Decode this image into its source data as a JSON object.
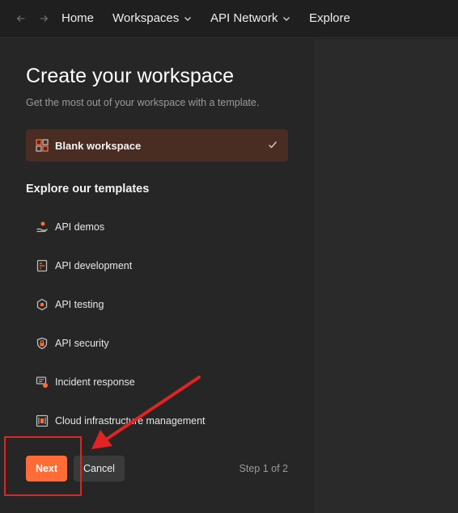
{
  "nav": {
    "back_icon": "arrow-left-icon",
    "forward_icon": "arrow-right-icon",
    "home": "Home",
    "workspaces": "Workspaces",
    "api_network": "API Network",
    "explore": "Explore"
  },
  "dialog": {
    "title": "Create your workspace",
    "subtitle": "Get the most out of your workspace with a template.",
    "blank": {
      "label": "Blank workspace",
      "selected": true
    },
    "templates_heading": "Explore our templates",
    "templates": [
      {
        "label": "API demos",
        "icon": "hand-api-icon"
      },
      {
        "label": "API development",
        "icon": "document-code-icon"
      },
      {
        "label": "API testing",
        "icon": "gear-hexagon-icon"
      },
      {
        "label": "API security",
        "icon": "shield-lock-icon"
      },
      {
        "label": "Incident response",
        "icon": "alert-monitor-icon"
      },
      {
        "label": "Cloud infrastructure management",
        "icon": "server-rack-icon"
      }
    ],
    "next_label": "Next",
    "cancel_label": "Cancel",
    "step_label": "Step 1 of 2"
  },
  "colors": {
    "accent": "#ff6c37",
    "selected_bg": "#4a2d22",
    "annotation": "#e02424"
  }
}
